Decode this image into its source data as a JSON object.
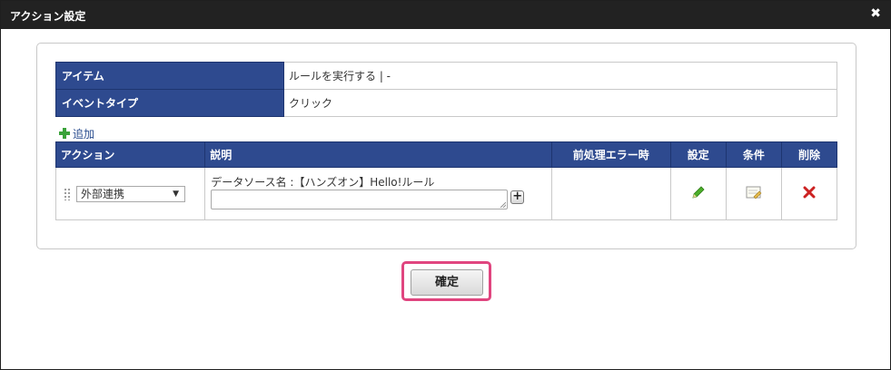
{
  "dialog": {
    "title": "アクション設定",
    "close": "✖"
  },
  "info": [
    {
      "label": "アイテム",
      "value": "ルールを実行する | -"
    },
    {
      "label": "イベントタイプ",
      "value": "クリック"
    }
  ],
  "add_link": "追加",
  "actions_table": {
    "headers": [
      "アクション",
      "説明",
      "前処理エラー時",
      "設定",
      "条件",
      "削除"
    ],
    "rows": [
      {
        "action": "外部連携",
        "description": "データソース名 :【ハンズオン】Hello!ルール",
        "description_input": "",
        "pre_error": ""
      }
    ]
  },
  "icons": {
    "edit": "pencil-icon",
    "condition": "note-icon",
    "delete": "delete-x-icon",
    "colors": {
      "accent": "#2e4a8f",
      "highlight": "#e0457f",
      "add": "#3aa23a",
      "delete": "#cc2222"
    }
  },
  "confirm_button": "確定"
}
